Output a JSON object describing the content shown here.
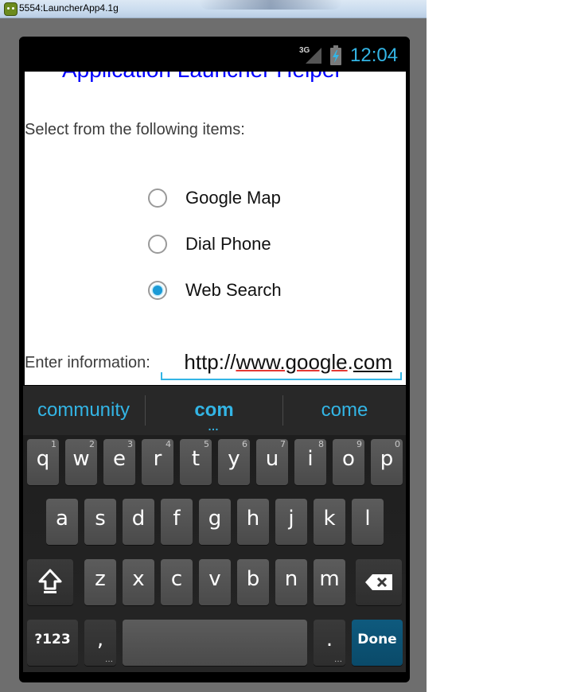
{
  "window": {
    "title": "5554:LauncherApp4.1g"
  },
  "status_bar": {
    "network": "3G",
    "time": "12:04"
  },
  "app": {
    "title": "Application Launcher Helper",
    "prompt": "Select from the following items:",
    "options": [
      {
        "label": "Google Map",
        "checked": false
      },
      {
        "label": "Dial Phone",
        "checked": false
      },
      {
        "label": "Web Search",
        "checked": true
      }
    ],
    "input_label": "Enter information:",
    "input_value": {
      "prefix": "http://",
      "spell_part": "www.google",
      "dot": ".",
      "composing_part": "com"
    }
  },
  "suggestions": {
    "left": "community",
    "middle": "com",
    "middle_more": "…",
    "right": "come"
  },
  "keyboard": {
    "row1": [
      {
        "ch": "q",
        "hint": "1"
      },
      {
        "ch": "w",
        "hint": "2"
      },
      {
        "ch": "e",
        "hint": "3"
      },
      {
        "ch": "r",
        "hint": "4"
      },
      {
        "ch": "t",
        "hint": "5"
      },
      {
        "ch": "y",
        "hint": "6"
      },
      {
        "ch": "u",
        "hint": "7"
      },
      {
        "ch": "i",
        "hint": "8"
      },
      {
        "ch": "o",
        "hint": "9"
      },
      {
        "ch": "p",
        "hint": "0"
      }
    ],
    "row2": [
      "a",
      "s",
      "d",
      "f",
      "g",
      "h",
      "j",
      "k",
      "l"
    ],
    "row3": [
      "z",
      "x",
      "c",
      "v",
      "b",
      "n",
      "m"
    ],
    "symbols_label": "?123",
    "comma": ",",
    "period": ".",
    "done_label": "Done",
    "ellipsis": "…"
  },
  "colors": {
    "accent": "#33b5e5",
    "title_blue": "#0000ff",
    "done_key": "#0a4a69"
  }
}
